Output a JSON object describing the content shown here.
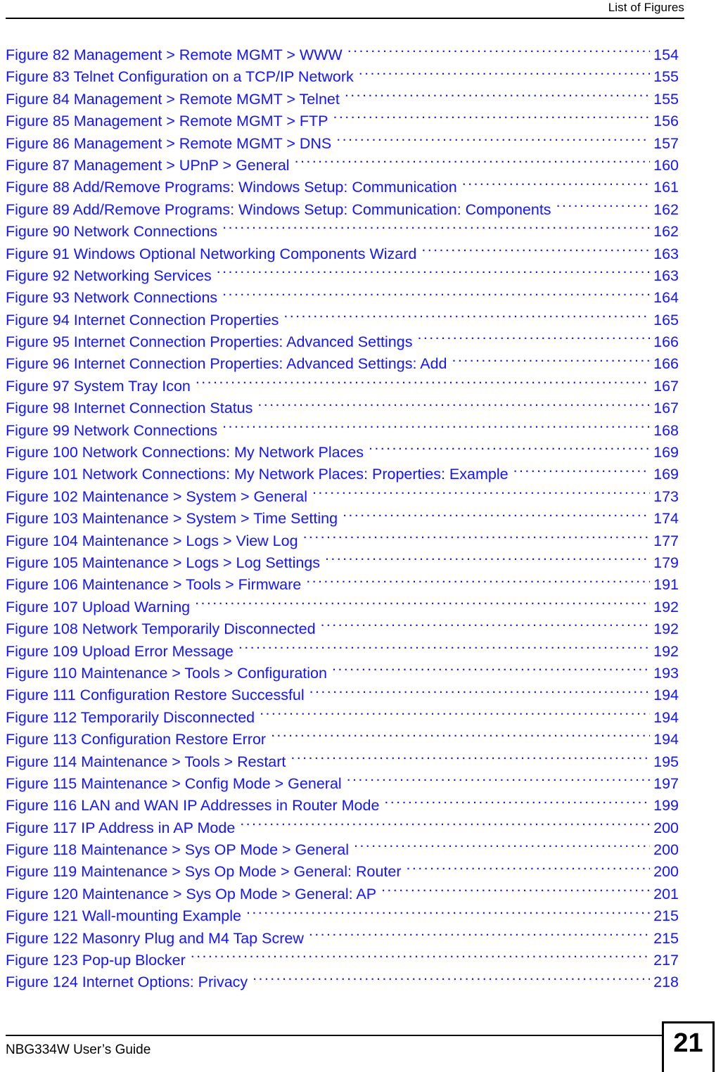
{
  "header": {
    "title": "List of Figures"
  },
  "toc": {
    "entries": [
      {
        "label": "Figure 82 Management > Remote MGMT > WWW",
        "page": "154"
      },
      {
        "label": "Figure 83 Telnet Configuration on a TCP/IP Network",
        "page": "155"
      },
      {
        "label": "Figure 84 Management > Remote MGMT > Telnet",
        "page": "155"
      },
      {
        "label": "Figure 85 Management > Remote MGMT > FTP",
        "page": "156"
      },
      {
        "label": "Figure 86 Management > Remote MGMT > DNS",
        "page": "157"
      },
      {
        "label": "Figure 87 Management > UPnP > General",
        "page": "160"
      },
      {
        "label": "Figure 88 Add/Remove Programs: Windows Setup: Communication",
        "page": "161"
      },
      {
        "label": "Figure 89 Add/Remove Programs: Windows Setup: Communication: Components",
        "page": "162"
      },
      {
        "label": "Figure 90 Network Connections",
        "page": "162"
      },
      {
        "label": "Figure 91 Windows Optional Networking Components Wizard",
        "page": "163"
      },
      {
        "label": "Figure 92 Networking Services",
        "page": "163"
      },
      {
        "label": "Figure 93 Network Connections",
        "page": "164"
      },
      {
        "label": "Figure 94 Internet Connection Properties",
        "page": "165"
      },
      {
        "label": "Figure 95 Internet Connection Properties: Advanced Settings",
        "page": "166"
      },
      {
        "label": "Figure 96 Internet Connection Properties: Advanced Settings: Add",
        "page": "166"
      },
      {
        "label": "Figure 97 System Tray Icon",
        "page": "167"
      },
      {
        "label": "Figure 98 Internet Connection Status",
        "page": "167"
      },
      {
        "label": "Figure 99 Network Connections",
        "page": "168"
      },
      {
        "label": "Figure 100 Network Connections: My Network Places",
        "page": "169"
      },
      {
        "label": "Figure 101 Network Connections: My Network Places: Properties: Example",
        "page": "169"
      },
      {
        "label": "Figure 102 Maintenance > System > General",
        "page": "173"
      },
      {
        "label": "Figure 103 Maintenance > System > Time Setting",
        "page": "174"
      },
      {
        "label": "Figure 104 Maintenance > Logs > View Log",
        "page": "177"
      },
      {
        "label": "Figure 105 Maintenance > Logs > Log Settings",
        "page": "179"
      },
      {
        "label": "Figure 106 Maintenance > Tools > Firmware",
        "page": "191"
      },
      {
        "label": "Figure 107 Upload Warning",
        "page": "192"
      },
      {
        "label": "Figure 108 Network Temporarily Disconnected",
        "page": "192"
      },
      {
        "label": "Figure 109 Upload Error Message",
        "page": "192"
      },
      {
        "label": "Figure 110 Maintenance > Tools > Configuration",
        "page": "193"
      },
      {
        "label": "Figure 111 Configuration Restore Successful",
        "page": "194"
      },
      {
        "label": "Figure 112 Temporarily Disconnected",
        "page": "194"
      },
      {
        "label": "Figure 113 Configuration Restore Error",
        "page": "194"
      },
      {
        "label": "Figure 114 Maintenance > Tools > Restart",
        "page": "195"
      },
      {
        "label": "Figure 115 Maintenance > Config Mode > General",
        "page": "197"
      },
      {
        "label": "Figure 116 LAN and WAN IP Addresses in Router Mode",
        "page": "199"
      },
      {
        "label": "Figure 117 IP Address in AP Mode",
        "page": "200"
      },
      {
        "label": "Figure 118 Maintenance > Sys OP Mode > General",
        "page": "200"
      },
      {
        "label": "Figure 119 Maintenance > Sys Op Mode > General: Router",
        "page": "200"
      },
      {
        "label": "Figure 120 Maintenance > Sys Op Mode > General: AP",
        "page": "201"
      },
      {
        "label": "Figure 121 Wall-mounting Example",
        "page": "215"
      },
      {
        "label": "Figure 122 Masonry Plug and M4 Tap Screw",
        "page": "215"
      },
      {
        "label": "Figure 123 Pop-up Blocker",
        "page": "217"
      },
      {
        "label": "Figure 124 Internet Options: Privacy",
        "page": "218"
      }
    ]
  },
  "footer": {
    "guide_title": "NBG334W User’s Guide",
    "page_number": "21"
  },
  "colors": {
    "entry_text": "#1414ff",
    "header_text": "#000000",
    "rule": "#000000",
    "background": "#ffffff"
  }
}
